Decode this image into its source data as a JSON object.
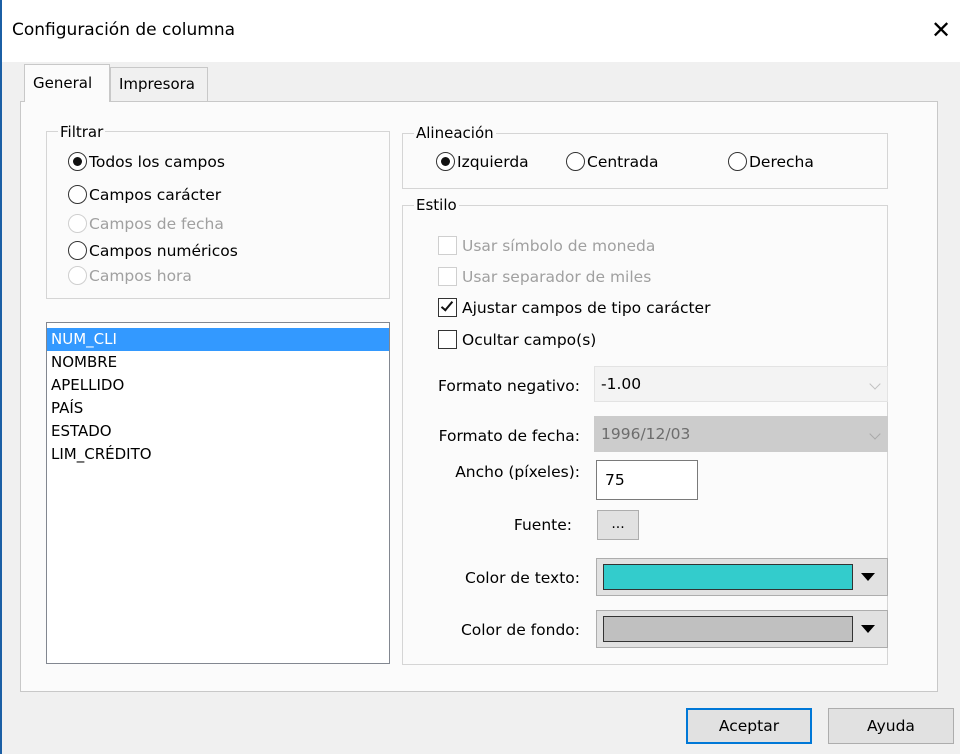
{
  "window": {
    "title": "Configuración de columna",
    "close_glyph": "✕"
  },
  "tabs": [
    {
      "label": "General",
      "active": true
    },
    {
      "label": "Impresora",
      "active": false
    }
  ],
  "filter": {
    "title": "Filtrar",
    "options": [
      {
        "label": "Todos los campos",
        "selected": true,
        "enabled": true
      },
      {
        "label": "Campos carácter",
        "selected": false,
        "enabled": true
      },
      {
        "label": "Campos de fecha",
        "selected": false,
        "enabled": false
      },
      {
        "label": "Campos numéricos",
        "selected": false,
        "enabled": true
      },
      {
        "label": "Campos hora",
        "selected": false,
        "enabled": false
      }
    ]
  },
  "fields": [
    "NUM_CLI",
    "NOMBRE",
    "APELLIDO",
    "PAÍS",
    "ESTADO",
    "LIM_CRÉDITO"
  ],
  "selected_field": "NUM_CLI",
  "alignment": {
    "title": "Alineación",
    "options": [
      {
        "label": "Izquierda",
        "selected": true
      },
      {
        "label": "Centrada",
        "selected": false
      },
      {
        "label": "Derecha",
        "selected": false
      }
    ]
  },
  "style": {
    "title": "Estilo",
    "checks": [
      {
        "label": "Usar símbolo de moneda",
        "checked": false,
        "enabled": false
      },
      {
        "label": "Usar separador de miles",
        "checked": false,
        "enabled": false
      },
      {
        "label": "Ajustar campos de tipo carácter",
        "checked": true,
        "enabled": true
      },
      {
        "label": "Ocultar campo(s)",
        "checked": false,
        "enabled": true
      }
    ],
    "negative_format_label": "Formato negativo:",
    "negative_format_value": "-1.00",
    "date_format_label": "Formato de fecha:",
    "date_format_value": "1996/12/03",
    "width_label": "Ancho (píxeles):",
    "width_value": "75",
    "font_label": "Fuente:",
    "font_button": "...",
    "text_color_label": "Color de texto:",
    "text_color": "#33cccc",
    "bg_color_label": "Color de fondo:",
    "bg_color": "#c0c0c0"
  },
  "buttons": {
    "ok": "Aceptar",
    "help": "Ayuda"
  },
  "colors": {
    "accent": "#0078d7",
    "selection": "#3399ff",
    "title_border": "#1b5fa5"
  }
}
